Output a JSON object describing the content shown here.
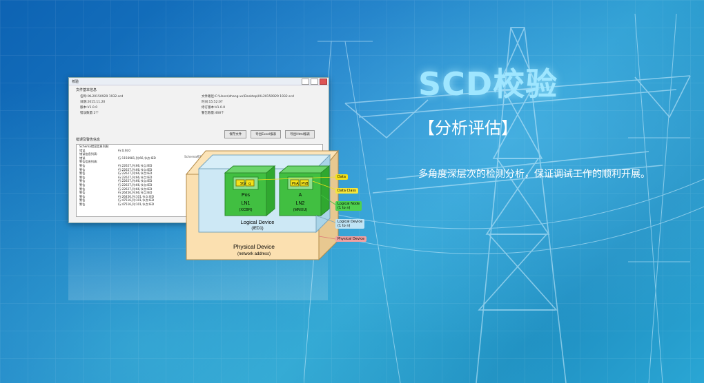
{
  "header": {
    "title": "SCD校验",
    "subtitle": "【分析评估】",
    "description": "多角度深层次的检测分析，保证调试工作的顺利开展。"
  },
  "window": {
    "title": "校验",
    "file_info_heading": "文件基本信息",
    "left_fields": [
      {
        "label": "名称:",
        "value": "IXL20150929 1932.scd"
      },
      {
        "label": "日期:",
        "value": "2015.11.20"
      },
      {
        "label": "版本:",
        "value": "V1.0.0"
      },
      {
        "label": "错误数量:",
        "value": "2个"
      }
    ],
    "right_fields": [
      {
        "label": "文件路径:",
        "value": "C:\\Users\\zhang-xx\\Desktop\\IXL20150929 1932.scd"
      },
      {
        "label": "时间:",
        "value": "15:52:07"
      },
      {
        "label": "修订版本:",
        "value": "V1.0.0"
      },
      {
        "label": "警告数量:",
        "value": "468个"
      }
    ],
    "buttons": [
      "保存文件",
      "导出Excel报表",
      "导出Html报表"
    ],
    "error_heading": "错误及警告信息",
    "error_rows": [
      {
        "type": "Schema错误信息列表:",
        "msg": ""
      },
      {
        "type": "错误",
        "msg": "行:0,列:0"
      },
      {
        "type": "错误信息列表:",
        "msg": ""
      },
      {
        "type": "错误",
        "msg": "行:1156981,列:66,节点:IED"
      },
      {
        "type": "警告信息列表:",
        "msg": ""
      },
      {
        "type": "警告",
        "msg": "行:22627,列:66,节点:IED"
      },
      {
        "type": "警告",
        "msg": "行:22627,列:66,节点:IED"
      },
      {
        "type": "警告",
        "msg": "行:22627,列:66,节点:IED"
      },
      {
        "type": "警告",
        "msg": "行:22627,列:66,节点:IED"
      },
      {
        "type": "警告",
        "msg": "行:22627,列:66,节点:IED"
      },
      {
        "type": "警告",
        "msg": "行:22627,列:66,节点:IED"
      },
      {
        "type": "警告",
        "msg": "行:22627,列:66,节点:IED"
      },
      {
        "type": "警告",
        "msg": "行:26456,列:66,节点:IED"
      },
      {
        "type": "警告",
        "msg": "行:26456,列:101,节点:IED"
      },
      {
        "type": "警告",
        "msg": "行:47516,列:101,节点:IED"
      },
      {
        "type": "警告",
        "msg": "行:47516,列:101,节点:IED"
      }
    ],
    "schema_note": "Schema校验信息"
  },
  "diagram": {
    "physical_device": "Physical Device",
    "physical_device_sub": "(network address)",
    "logical_device": "Logical Device",
    "logical_device_sub": "(IED1)",
    "ln1_name": "Pos",
    "ln1_label": "LN1",
    "ln1_sub": "(XCBR)",
    "ln1_data": [
      "StV",
      "q"
    ],
    "ln2_name": "A",
    "ln2_label": "LN2",
    "ln2_sub": "(MMXU)",
    "ln2_data": [
      "PhA",
      "PhB"
    ],
    "tags": [
      {
        "text": "Data",
        "color": "#f3e11a"
      },
      {
        "text": "Data Class",
        "color": "#f7e63a"
      },
      {
        "text": "Logical Node",
        "color": "#4fd14f"
      },
      {
        "text": "(1 to n)",
        "color": "#4fd14f"
      },
      {
        "text": "Logical Device",
        "color": "#bfe4f5"
      },
      {
        "text": "(1 to n)",
        "color": "#bfe4f5"
      },
      {
        "text": "Physical Device",
        "color": "#f2a1a1"
      }
    ]
  }
}
